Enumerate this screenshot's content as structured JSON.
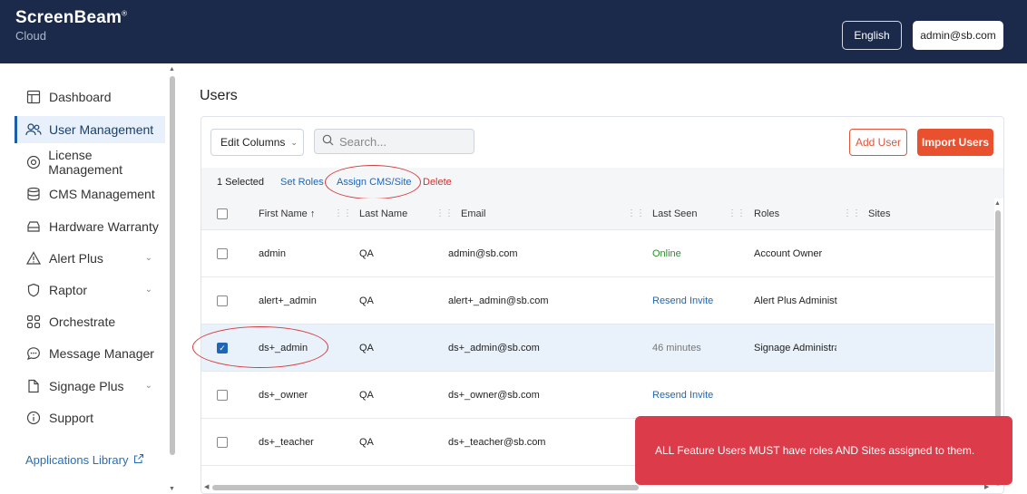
{
  "header": {
    "brand_name": "ScreenBeam",
    "brand_mark": "®",
    "brand_sub": "Cloud",
    "language": "English",
    "user": "admin@sb.com",
    "color": "#1b2a4a"
  },
  "sidebar": {
    "items": [
      {
        "label": "Dashboard",
        "icon": "layout-icon"
      },
      {
        "label": "User Management",
        "icon": "users-icon",
        "active": true
      },
      {
        "label": "License Management",
        "icon": "license-icon"
      },
      {
        "label": "CMS Management",
        "icon": "database-icon"
      },
      {
        "label": "Hardware Warranty",
        "icon": "hardware-icon"
      },
      {
        "label": "Alert Plus",
        "icon": "alert-icon",
        "expandable": true
      },
      {
        "label": "Raptor",
        "icon": "shield-icon",
        "expandable": true
      },
      {
        "label": "Orchestrate",
        "icon": "grid-icon"
      },
      {
        "label": "Message Manager",
        "icon": "message-icon",
        "expandable": true
      },
      {
        "label": "Signage Plus",
        "icon": "file-icon",
        "expandable": true
      },
      {
        "label": "Support",
        "icon": "info-icon"
      }
    ],
    "apps_link": "Applications Library"
  },
  "main": {
    "title": "Users",
    "edit_columns": "Edit Columns",
    "search_placeholder": "Search...",
    "add_user": "Add User",
    "import_users": "Import Users",
    "selection": {
      "count": "1 Selected",
      "set_roles": "Set Roles",
      "assign": "Assign CMS/Site",
      "delete": "Delete"
    },
    "columns": [
      "First Name ↑",
      "Last Name",
      "Email",
      "Last Seen",
      "Roles",
      "Sites"
    ],
    "rows": [
      {
        "first": "admin",
        "last": "QA",
        "email": "admin@sb.com",
        "seen": "Online",
        "seen_style": "green",
        "role": "Account Owner",
        "site": "",
        "checked": false
      },
      {
        "first": "alert+_admin",
        "last": "QA",
        "email": "alert+_admin@sb.com",
        "seen": "Resend Invite",
        "seen_style": "blue",
        "role": "Alert Plus Administ",
        "site": "",
        "checked": false
      },
      {
        "first": "ds+_admin",
        "last": "QA",
        "email": "ds+_admin@sb.com",
        "seen": "46 minutes",
        "seen_style": "grey",
        "role": "Signage Administra",
        "site": "",
        "checked": true
      },
      {
        "first": "ds+_owner",
        "last": "QA",
        "email": "ds+_owner@sb.com",
        "seen": "Resend Invite",
        "seen_style": "blue",
        "role": "",
        "site": "",
        "checked": false
      },
      {
        "first": "ds+_teacher",
        "last": "QA",
        "email": "ds+_teacher@sb.com",
        "seen": "",
        "seen_style": "grey",
        "role": "",
        "site": "",
        "checked": false
      }
    ]
  },
  "toast": {
    "message": "ALL Feature Users MUST have roles AND Sites assigned to them.",
    "color": "#dc3c4a"
  }
}
